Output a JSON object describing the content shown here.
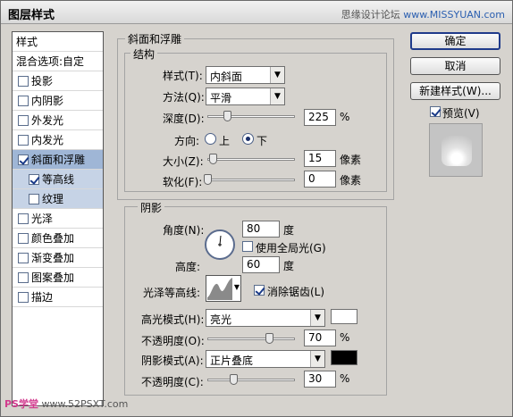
{
  "window": {
    "title": "图层样式",
    "watermark_text": "思缘设计论坛",
    "watermark_url": "www.MISSYUAN.com"
  },
  "style_list": {
    "header": "样式",
    "blend_options": "混合选项:自定",
    "items": [
      {
        "label": "投影",
        "checked": false
      },
      {
        "label": "内阴影",
        "checked": false
      },
      {
        "label": "外发光",
        "checked": false
      },
      {
        "label": "内发光",
        "checked": false
      },
      {
        "label": "斜面和浮雕",
        "checked": true,
        "selected": true
      },
      {
        "label": "等高线",
        "checked": true,
        "sub": true
      },
      {
        "label": "纹理",
        "checked": false,
        "sub": true
      },
      {
        "label": "光泽",
        "checked": false
      },
      {
        "label": "颜色叠加",
        "checked": false
      },
      {
        "label": "渐变叠加",
        "checked": false
      },
      {
        "label": "图案叠加",
        "checked": false
      },
      {
        "label": "描边",
        "checked": false
      }
    ]
  },
  "bevel": {
    "title": "斜面和浮雕",
    "structure": {
      "title": "结构",
      "style_label": "样式(T):",
      "style_value": "内斜面",
      "technique_label": "方法(Q):",
      "technique_value": "平滑",
      "depth_label": "深度(D):",
      "depth_value": "225",
      "depth_unit": "%",
      "depth_level": 0.22,
      "direction_label": "方向:",
      "direction_up": "上",
      "direction_down": "下",
      "direction_selected": "下",
      "size_label": "大小(Z):",
      "size_value": "15",
      "size_unit": "像素",
      "size_level": 0.06,
      "soften_label": "软化(F):",
      "soften_value": "0",
      "soften_unit": "像素",
      "soften_level": 0.0
    },
    "shading": {
      "title": "阴影",
      "angle_label": "角度(N):",
      "angle_value": "80",
      "angle_unit": "度",
      "global_light_label": "使用全局光(G)",
      "global_light_checked": false,
      "altitude_label": "高度:",
      "altitude_value": "60",
      "altitude_unit": "度",
      "gloss_contour_label": "光泽等高线:",
      "anti_aliased_label": "消除锯齿(L)",
      "anti_aliased_checked": true,
      "highlight_mode_label": "高光模式(H):",
      "highlight_mode_value": "亮光",
      "highlight_color": "#ffffff",
      "highlight_opacity_label": "不透明度(O):",
      "highlight_opacity_value": "70",
      "highlight_opacity_unit": "%",
      "highlight_opacity_level": 0.7,
      "shadow_mode_label": "阴影模式(A):",
      "shadow_mode_value": "正片叠底",
      "shadow_color": "#000000",
      "shadow_opacity_label": "不透明度(C):",
      "shadow_opacity_value": "30",
      "shadow_opacity_unit": "%",
      "shadow_opacity_level": 0.3
    }
  },
  "buttons": {
    "ok": "确定",
    "cancel": "取消",
    "new_style": "新建样式(W)...",
    "preview_label": "预览(V)",
    "preview_checked": true
  },
  "footer": {
    "ps_label": "PS学堂",
    "url": "www.52PSXT.com"
  }
}
